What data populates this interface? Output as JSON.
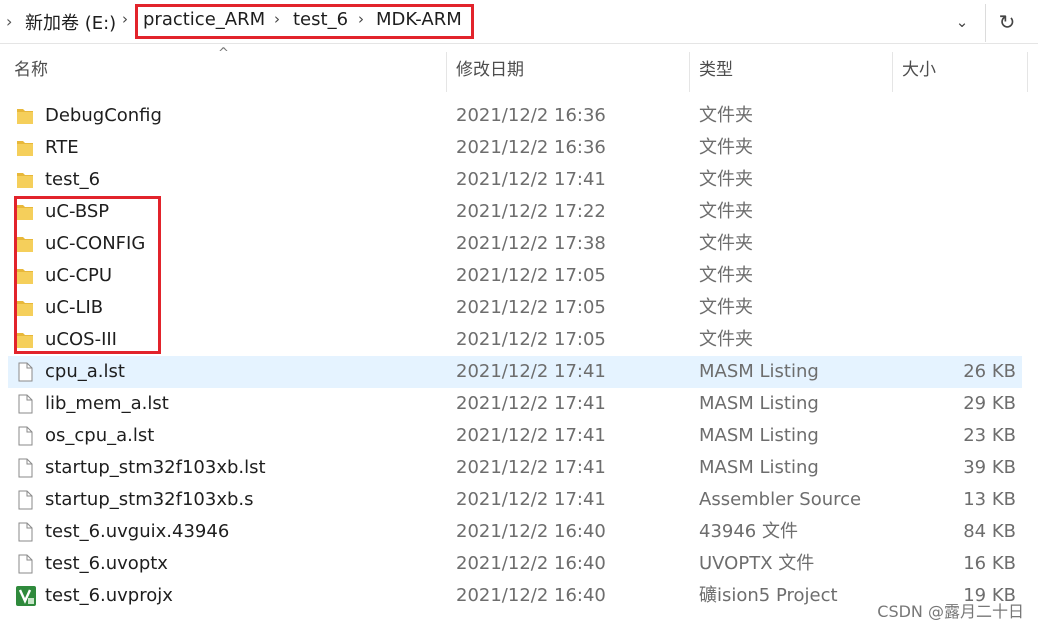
{
  "address_bar": {
    "drive": "新加卷 (E:)",
    "crumbs": [
      "practice_ARM",
      "test_6",
      "MDK-ARM"
    ]
  },
  "columns": {
    "name": "名称",
    "date": "修改日期",
    "type": "类型",
    "size": "大小"
  },
  "files": [
    {
      "name": "DebugConfig",
      "date": "2021/12/2 16:36",
      "type": "文件夹",
      "size": "",
      "icon": "folder-icon"
    },
    {
      "name": "RTE",
      "date": "2021/12/2 16:36",
      "type": "文件夹",
      "size": "",
      "icon": "folder-icon"
    },
    {
      "name": "test_6",
      "date": "2021/12/2 17:41",
      "type": "文件夹",
      "size": "",
      "icon": "folder-icon"
    },
    {
      "name": "uC-BSP",
      "date": "2021/12/2 17:22",
      "type": "文件夹",
      "size": "",
      "icon": "folder-icon"
    },
    {
      "name": "uC-CONFIG",
      "date": "2021/12/2 17:38",
      "type": "文件夹",
      "size": "",
      "icon": "folder-icon"
    },
    {
      "name": "uC-CPU",
      "date": "2021/12/2 17:05",
      "type": "文件夹",
      "size": "",
      "icon": "folder-icon"
    },
    {
      "name": "uC-LIB",
      "date": "2021/12/2 17:05",
      "type": "文件夹",
      "size": "",
      "icon": "folder-icon"
    },
    {
      "name": "uCOS-III",
      "date": "2021/12/2 17:05",
      "type": "文件夹",
      "size": "",
      "icon": "folder-icon"
    },
    {
      "name": "cpu_a.lst",
      "date": "2021/12/2 17:41",
      "type": "MASM Listing",
      "size": "26 KB",
      "icon": "file-icon"
    },
    {
      "name": "lib_mem_a.lst",
      "date": "2021/12/2 17:41",
      "type": "MASM Listing",
      "size": "29 KB",
      "icon": "file-icon"
    },
    {
      "name": "os_cpu_a.lst",
      "date": "2021/12/2 17:41",
      "type": "MASM Listing",
      "size": "23 KB",
      "icon": "file-icon"
    },
    {
      "name": "startup_stm32f103xb.lst",
      "date": "2021/12/2 17:41",
      "type": "MASM Listing",
      "size": "39 KB",
      "icon": "file-icon"
    },
    {
      "name": "startup_stm32f103xb.s",
      "date": "2021/12/2 17:41",
      "type": "Assembler Source",
      "size": "13 KB",
      "icon": "file-icon"
    },
    {
      "name": "test_6.uvguix.43946",
      "date": "2021/12/2 16:40",
      "type": "43946 文件",
      "size": "84 KB",
      "icon": "file-icon"
    },
    {
      "name": "test_6.uvoptx",
      "date": "2021/12/2 16:40",
      "type": "UVOPTX 文件",
      "size": "16 KB",
      "icon": "file-icon"
    },
    {
      "name": "test_6.uvprojx",
      "date": "2021/12/2 16:40",
      "type": "礦ision5 Project",
      "size": "19 KB",
      "icon": "keil-project-icon"
    }
  ],
  "watermark": "CSDN @露月二十日",
  "colors": {
    "highlight_box": "#e2232b",
    "selected_row": "#e5f3ff",
    "folder": "#f0c44a"
  }
}
